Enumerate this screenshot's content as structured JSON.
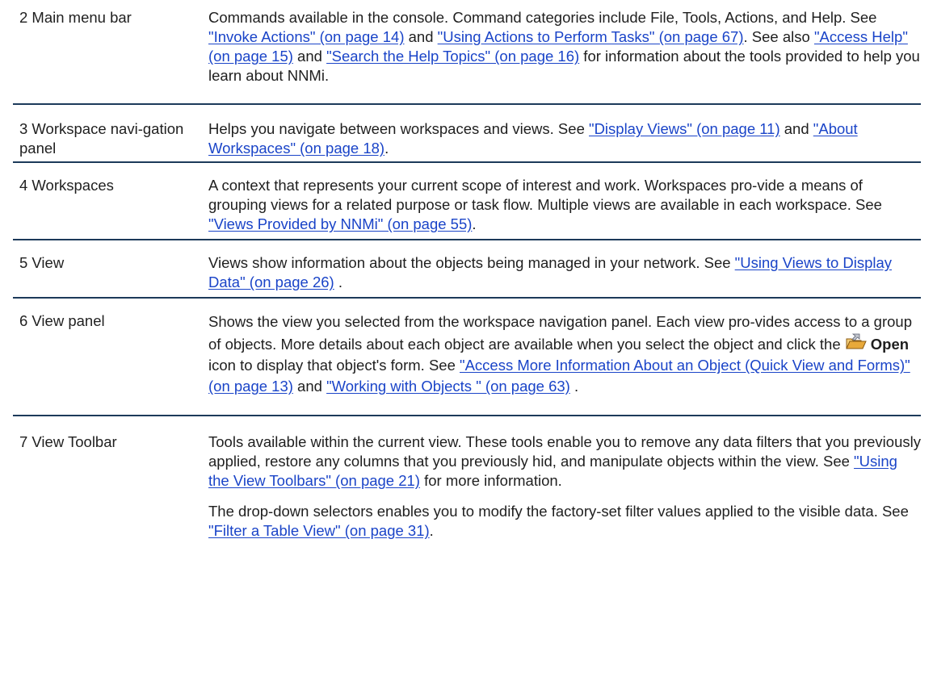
{
  "rows": [
    {
      "label": "2 Main menu bar",
      "segments": [
        {
          "type": "text",
          "text": "Commands available in the console. Command categories include File, Tools, Actions, and Help. See "
        },
        {
          "type": "link",
          "text": "\"Invoke Actions\" (on page 14)"
        },
        {
          "type": "text",
          "text": " and "
        },
        {
          "type": "link",
          "text": "\"Using Actions to Perform Tasks\" (on page 67)"
        },
        {
          "type": "text",
          "text": ". See also "
        },
        {
          "type": "link",
          "text": "\"Access Help\" (on page 15)"
        },
        {
          "type": "text",
          "text": " and "
        },
        {
          "type": "link",
          "text": "\"Search the Help Topics\" (on page 16)"
        },
        {
          "type": "text",
          "text": " for information about the tools provided to help you learn about NNMi."
        }
      ]
    },
    {
      "label": "3 Workspace navi-gation panel",
      "segments": [
        {
          "type": "text",
          "text": "Helps you navigate between workspaces and views. See "
        },
        {
          "type": "link",
          "text": "\"Display Views\" (on page 11)"
        },
        {
          "type": "text",
          "text": " and "
        },
        {
          "type": "link",
          "text": "\"About Workspaces\" (on page 18)"
        },
        {
          "type": "text",
          "text": "."
        }
      ]
    },
    {
      "label": "4 Workspaces",
      "segments": [
        {
          "type": "text",
          "text": "A context that represents your current scope of interest and work. Workspaces pro-vide a means of grouping views for a related purpose or task flow. Multiple views are available in each workspace. See "
        },
        {
          "type": "link",
          "text": "\"Views Provided by NNMi\" (on page 55)"
        },
        {
          "type": "text",
          "text": "."
        }
      ]
    },
    {
      "label": "5 View",
      "segments": [
        {
          "type": "text",
          "text": "Views show information about the objects being managed in your network. See "
        },
        {
          "type": "link",
          "text": "\"Using Views to Display Data\" (on page 26)"
        },
        {
          "type": "text",
          "text": " ."
        }
      ]
    },
    {
      "label": "6 View panel",
      "segments": [
        {
          "type": "text",
          "text": "Shows the view you selected from the workspace navigation panel. Each view pro-vides access to a group of objects. More details about each object are available when you select the object and click the "
        },
        {
          "type": "icon",
          "name": "open-icon"
        },
        {
          "type": "bold",
          "text": "Open"
        },
        {
          "type": "text",
          "text": " icon to display that object's form. See "
        },
        {
          "type": "link",
          "text": "\"Access More Information About an Object (Quick View and Forms)\" (on page 13)"
        },
        {
          "type": "text",
          "text": " and "
        },
        {
          "type": "link",
          "text": "\"Working with Objects \" (on page 63)"
        },
        {
          "type": "text",
          "text": " ."
        }
      ]
    },
    {
      "label": "7 View Toolbar",
      "segments": [
        {
          "type": "text",
          "text": "Tools available within the current view. These tools enable you to remove any data filters that you previously applied, restore any columns that you previously hid, and manipulate objects within the view. See "
        },
        {
          "type": "link",
          "text": "\"Using the View Toolbars\" (on page 21)"
        },
        {
          "type": "text",
          "text": " for more information."
        }
      ],
      "segments2": [
        {
          "type": "text",
          "text": "The drop-down selectors enables you to modify the factory-set filter values applied to the visible data. See "
        },
        {
          "type": "link",
          "text": "\"Filter a Table View\" (on page 31)"
        },
        {
          "type": "text",
          "text": "."
        }
      ]
    }
  ],
  "colors": {
    "link": "#1a44c8",
    "rule": "#1c3a5a",
    "text": "#1f1f1f"
  }
}
